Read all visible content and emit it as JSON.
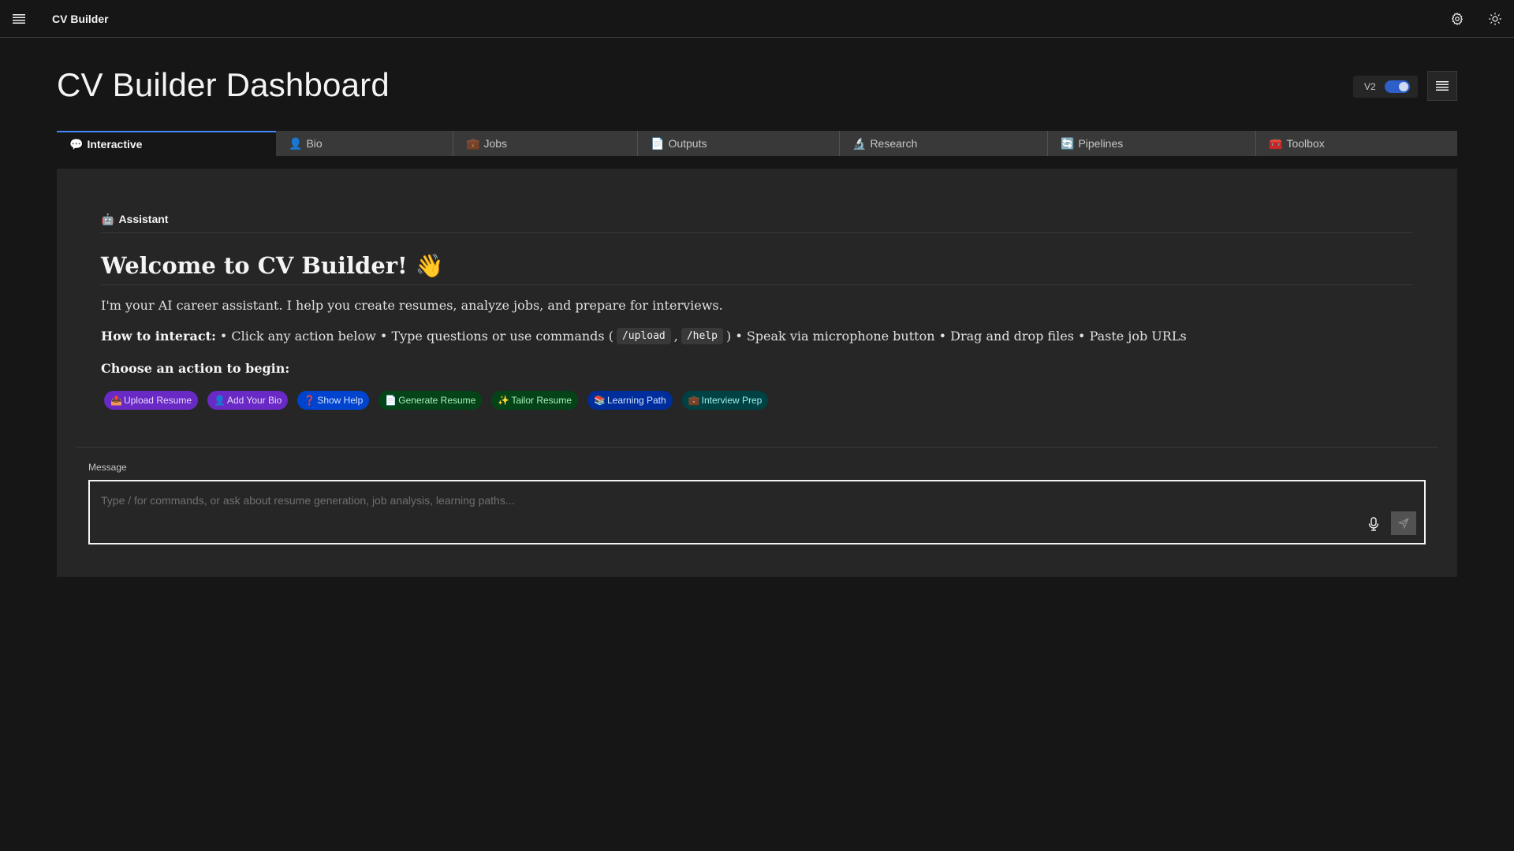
{
  "header": {
    "app_name": "CV Builder"
  },
  "page": {
    "title": "CV Builder Dashboard",
    "version_label": "V2"
  },
  "tabs": [
    {
      "emoji": "💬",
      "label": "Interactive"
    },
    {
      "emoji": "👤",
      "label": "Bio"
    },
    {
      "emoji": "💼",
      "label": "Jobs"
    },
    {
      "emoji": "📄",
      "label": "Outputs"
    },
    {
      "emoji": "🔬",
      "label": "Research"
    },
    {
      "emoji": "🔄",
      "label": "Pipelines"
    },
    {
      "emoji": "🧰",
      "label": "Toolbox"
    }
  ],
  "assistant": {
    "emoji": "🤖",
    "label": "Assistant",
    "welcome_title": "Welcome to CV Builder! 👋",
    "intro": "I'm your AI career assistant. I help you create resumes, analyze jobs, and prepare for interviews.",
    "how_label": "How to interact:",
    "how_part1": "• Click any action below • Type questions or use commands (",
    "cmd_upload": "/upload",
    "how_comma": ",",
    "cmd_help": "/help",
    "how_part2": ") • Speak via microphone button • Drag and drop files • Paste job URLs",
    "choose_label": "Choose an action to begin:"
  },
  "actions": [
    {
      "emoji": "📤",
      "label": "Upload Resume"
    },
    {
      "emoji": "👤",
      "label": "Add Your Bio"
    },
    {
      "emoji": "❓",
      "label": "Show Help"
    },
    {
      "emoji": "📄",
      "label": "Generate Resume"
    },
    {
      "emoji": "✨",
      "label": "Tailor Resume"
    },
    {
      "emoji": "📚",
      "label": "Learning Path"
    },
    {
      "emoji": "💼",
      "label": "Interview Prep"
    }
  ],
  "message": {
    "label": "Message",
    "value": "",
    "placeholder": "Type / for commands, or ask about resume generation, job analysis, learning paths..."
  },
  "colors": {
    "accent": "#4589ff",
    "toggle_on": "#2d5ec9",
    "background": "#161616",
    "panel": "#262626"
  },
  "icons": {
    "hamburger": "hamburger-menu-icon",
    "settings": "gear-icon",
    "theme": "sun-icon",
    "menu": "list-icon",
    "mic": "microphone-icon",
    "send": "send-icon"
  }
}
